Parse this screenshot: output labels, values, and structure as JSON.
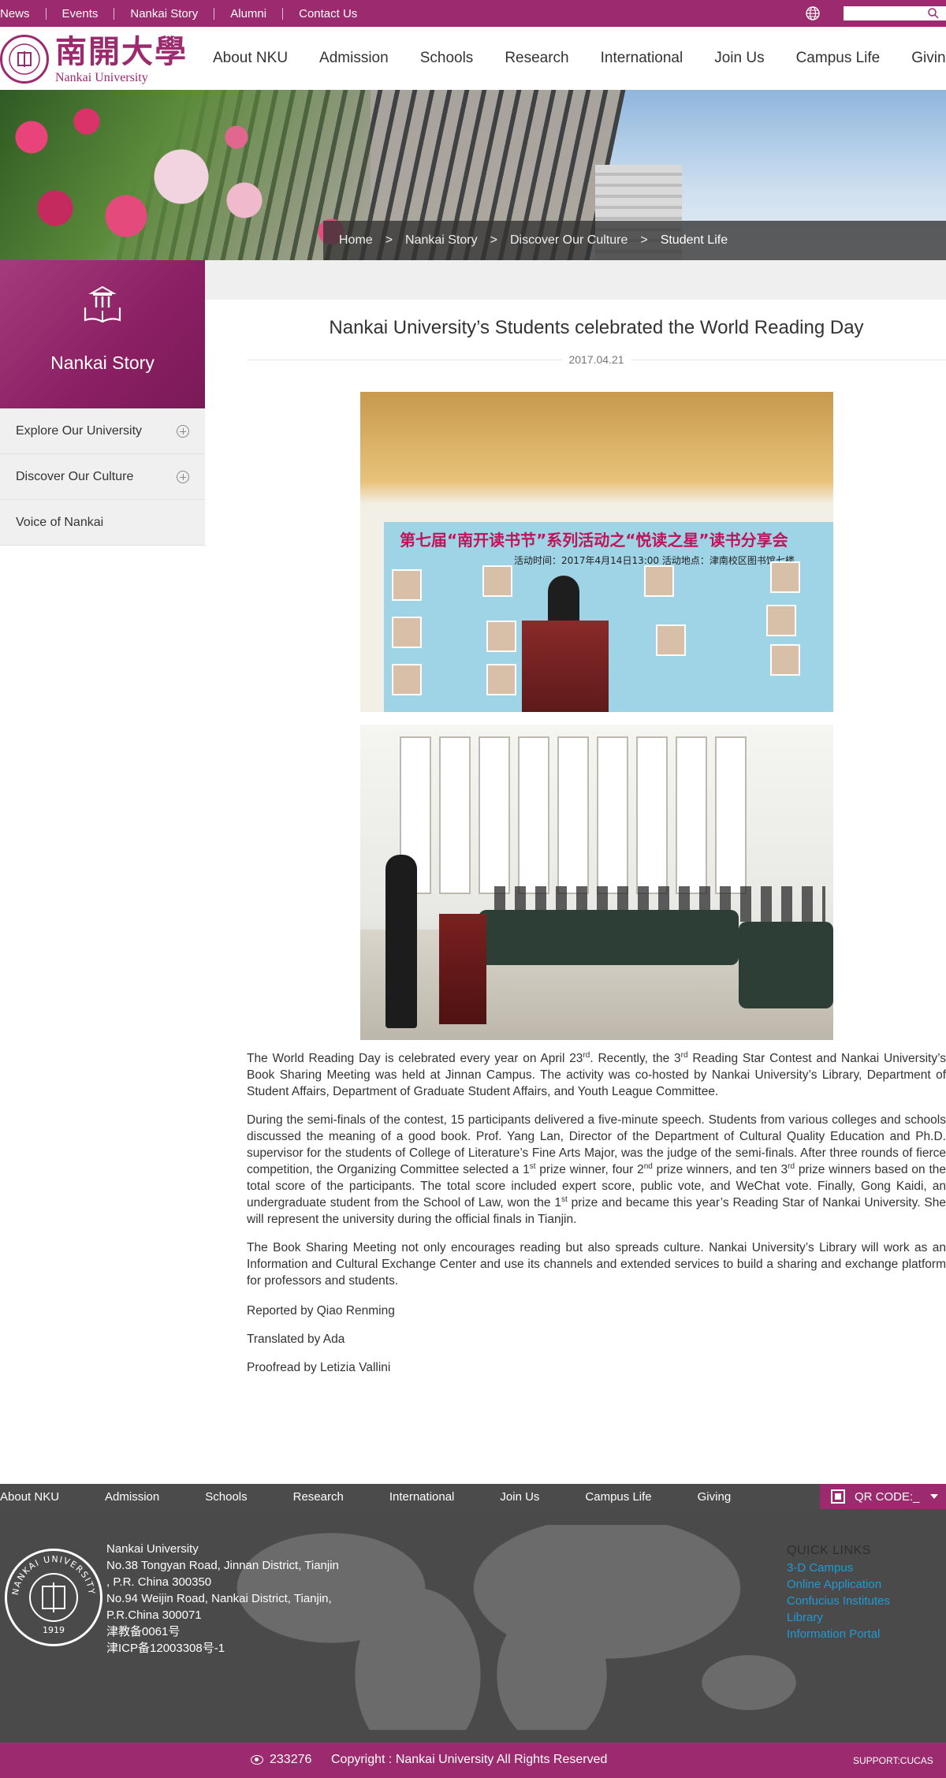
{
  "topbar": {
    "links": [
      "News",
      "Events",
      "Nankai Story",
      "Alumni",
      "Contact Us"
    ],
    "search_placeholder": ""
  },
  "header": {
    "logo_cn": "南開大學",
    "logo_en": "Nankai University",
    "nav": [
      "About NKU",
      "Admission",
      "Schools",
      "Research",
      "International",
      "Join Us",
      "Campus Life",
      "Giving"
    ]
  },
  "breadcrumb": {
    "items": [
      "Home",
      "Nankai Story",
      "Discover Our Culture",
      "Student Life"
    ],
    "separator": ">"
  },
  "sidebar": {
    "title": "Nankai Story",
    "items": [
      {
        "label": "Explore Our University",
        "expandable": true
      },
      {
        "label": "Discover Our Culture",
        "expandable": true
      },
      {
        "label": "Voice of Nankai",
        "expandable": false
      }
    ]
  },
  "article": {
    "title": "Nankai University’s Students celebrated the World Reading Day",
    "date": "2017.04.21",
    "photo1": {
      "headline": "第七届“南开读书节”系列活动之“悦读之星”读书分享会",
      "subline": "活动时间：2017年4月14日13:00  活动地点：津南校区图书馆七楼"
    },
    "p1": {
      "a": "The World Reading Day is celebrated every year on April 23",
      "a_sup": "rd",
      "b": ". Recently, the 3",
      "b_sup": "rd",
      "c": " Reading Star Contest and Nankai University’s Book Sharing Meeting was held at Jinnan Campus. The activity was co-hosted by Nankai University’s Library, Department of Student Affairs, Department of Graduate Student Affairs, and Youth League Committee."
    },
    "p2": {
      "a": "During the semi-finals of the contest, 15 participants delivered a five-minute speech. Students from various colleges and schools discussed the meaning of a good book. Prof. Yang Lan, Director of the Department of Cultural Quality Education and Ph.D. supervisor for the students of College of Literature’s Fine Arts Major, was the judge of the semi-finals. After three rounds of fierce competition, the Organizing Committee selected a 1",
      "a_sup": "st",
      "b": " prize winner, four 2",
      "b_sup": "nd",
      "c": " prize winners, and ten 3",
      "c_sup": "rd",
      "d": " prize winners based on the total score of the participants. The total score included expert score, public vote, and WeChat vote. Finally, Gong Kaidi, an undergraduate student from the School of Law, won the 1",
      "d_sup": "st",
      "e": " prize and became this year’s Reading Star of Nankai University. She will represent the university during the official finals in Tianjin."
    },
    "p3": "The Book Sharing Meeting not only encourages reading but also spreads culture. Nankai University’s Library will work as an Information and Cultural Exchange Center and use its channels and extended services to build a sharing and exchange platform for professors and students.",
    "reported": "Reported by Qiao Renming",
    "translated": "Translated by Ada",
    "proofread": "Proofread by Letizia Vallini"
  },
  "footer": {
    "nav": [
      "About NKU",
      "Admission",
      "Schools",
      "Research",
      "International",
      "Join Us",
      "Campus Life",
      "Giving"
    ],
    "qr_label": "QR CODE:_",
    "seal_text": "NANKAI UNIVERSITY",
    "seal_year": "1919",
    "address_lines": [
      "Nankai University",
      "No.38 Tongyan Road, Jinnan District, Tianjin",
      ", P.R. China 300350",
      "No.94 Weijin Road,  Nankai District, Tianjin,",
      "P.R.China  300071",
      "津教备0061号",
      "津ICP备12003308号-1"
    ],
    "quick_links_title": "QUICK LINKS",
    "quick_links": [
      "3-D Campus",
      "Online Application",
      "Confucius Institutes",
      "Library",
      "Information Portal"
    ],
    "visit_count": "233276",
    "copyright": "Copyright : Nankai University All Rights Reserved",
    "support": "SUPPORT:CUCAS"
  },
  "colors": {
    "brand": "#9c2a6e",
    "footer_bg": "#4a4a4a",
    "link_blue": "#1e9bd7"
  }
}
